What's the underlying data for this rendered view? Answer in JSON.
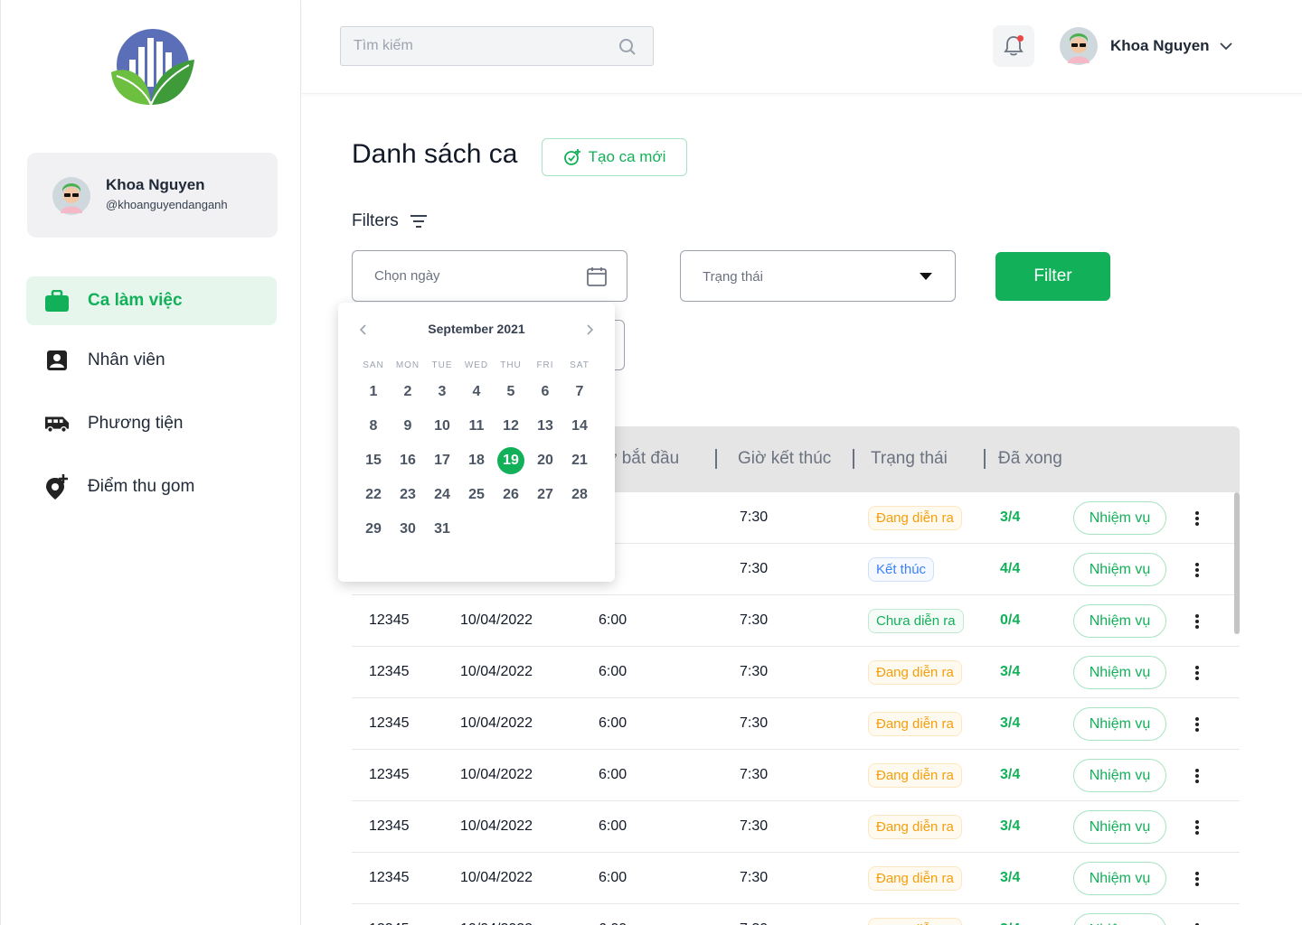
{
  "brand": {
    "accent": "#12b059",
    "logo_colors": [
      "#5b6fb8",
      "#6cbf3f",
      "#3f9a3a"
    ]
  },
  "sidebar": {
    "profile": {
      "name": "Khoa Nguyen",
      "handle": "@khoanguyendanganh"
    },
    "items": [
      {
        "label": "Ca làm việc",
        "icon": "briefcase-icon",
        "active": true
      },
      {
        "label": "Nhân viên",
        "icon": "contact-card-icon",
        "active": false
      },
      {
        "label": "Phương tiện",
        "icon": "bus-icon",
        "active": false
      },
      {
        "label": "Điểm thu gom",
        "icon": "add-location-icon",
        "active": false
      }
    ]
  },
  "header": {
    "search_placeholder": "Tìm kiếm",
    "user_name": "Khoa Nguyen",
    "notification_dot_color": "#ef4444"
  },
  "main": {
    "title": "Danh sách ca",
    "create_label": "Tạo ca mới",
    "filters_label": "Filters",
    "date_placeholder": "Chọn ngày",
    "status_placeholder": "Trạng thái",
    "filter_button": "Filter"
  },
  "calendar": {
    "title": "September 2021",
    "weekdays": [
      "SAN",
      "MON",
      "TUE",
      "WED",
      "THU",
      "FRI",
      "SAT"
    ],
    "days": [
      "1",
      "2",
      "3",
      "4",
      "5",
      "6",
      "7",
      "8",
      "9",
      "10",
      "11",
      "12",
      "13",
      "14",
      "15",
      "16",
      "17",
      "18",
      "19",
      "20",
      "21",
      "22",
      "23",
      "24",
      "25",
      "26",
      "27",
      "28",
      "29",
      "30",
      "31"
    ],
    "selected": "19"
  },
  "table": {
    "headers": [
      "ờ bắt đầu",
      "Giờ kết thúc",
      "Trạng thái",
      "Đã xong"
    ],
    "task_label": "Nhiệm vụ",
    "rows": [
      {
        "id": "",
        "date": "",
        "start": "00",
        "end": "7:30",
        "status": "Đang diễn ra",
        "status_type": "ongoing",
        "done": "3/4"
      },
      {
        "id": "",
        "date": "",
        "start": "00",
        "end": "7:30",
        "status": "Kết thúc",
        "status_type": "done",
        "done": "4/4"
      },
      {
        "id": "12345",
        "date": "10/04/2022",
        "start": "6:00",
        "end": "7:30",
        "status": "Chưa diễn ra",
        "status_type": "pending",
        "done": "0/4"
      },
      {
        "id": "12345",
        "date": "10/04/2022",
        "start": "6:00",
        "end": "7:30",
        "status": "Đang diễn ra",
        "status_type": "ongoing",
        "done": "3/4"
      },
      {
        "id": "12345",
        "date": "10/04/2022",
        "start": "6:00",
        "end": "7:30",
        "status": "Đang diễn ra",
        "status_type": "ongoing",
        "done": "3/4"
      },
      {
        "id": "12345",
        "date": "10/04/2022",
        "start": "6:00",
        "end": "7:30",
        "status": "Đang diễn ra",
        "status_type": "ongoing",
        "done": "3/4"
      },
      {
        "id": "12345",
        "date": "10/04/2022",
        "start": "6:00",
        "end": "7:30",
        "status": "Đang diễn ra",
        "status_type": "ongoing",
        "done": "3/4"
      },
      {
        "id": "12345",
        "date": "10/04/2022",
        "start": "6:00",
        "end": "7:30",
        "status": "Đang diễn ra",
        "status_type": "ongoing",
        "done": "3/4"
      },
      {
        "id": "12345",
        "date": "10/04/2022",
        "start": "6:00",
        "end": "7:30",
        "status": "Đang diễn ra",
        "status_type": "ongoing",
        "done": "3/4"
      }
    ]
  }
}
